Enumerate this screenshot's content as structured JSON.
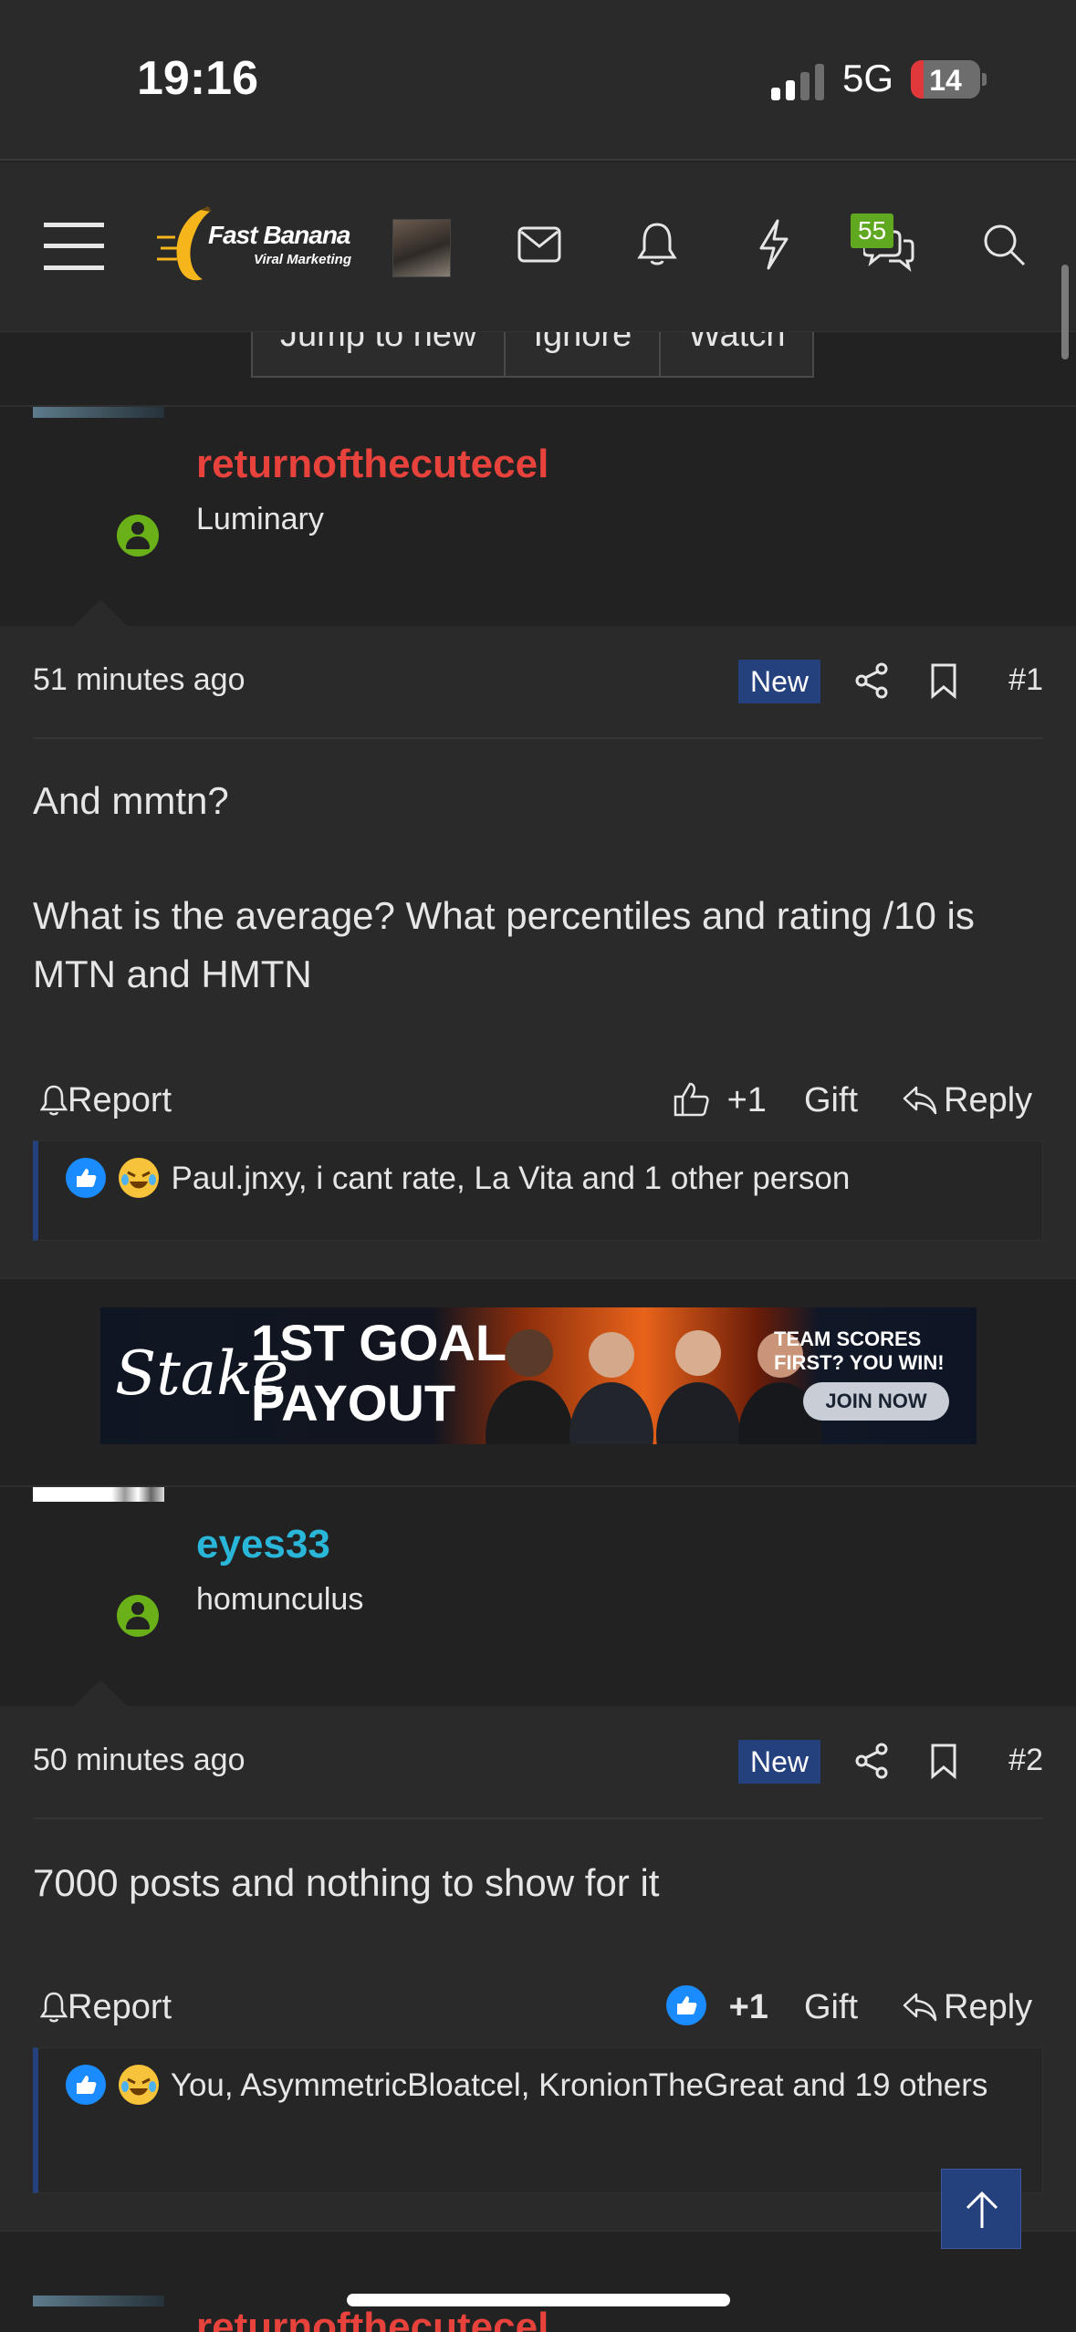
{
  "status_bar": {
    "time": "19:16",
    "network": "5G",
    "battery": "14"
  },
  "nav": {
    "logo_title": "Fast Banana",
    "logo_subtitle": "Viral Marketing",
    "chat_badge": "55",
    "icons": [
      "menu-icon",
      "mail-icon",
      "bell-icon",
      "lightning-icon",
      "chat-icon",
      "search-icon"
    ]
  },
  "thread_tabs": [
    "Jump to new",
    "Ignore",
    "Watch"
  ],
  "posts": [
    {
      "username": "returnofthecutecel",
      "user_color": "#e8423c",
      "user_title": "Luminary",
      "time": "51 minutes ago",
      "new_label": "New",
      "number": "#1",
      "content": [
        "And mmtn?",
        "What is the average? What percentiles and rating /10 is MTN and HMTN"
      ],
      "report": "Report",
      "like_count": "+1",
      "gift": "Gift",
      "reply": "Reply",
      "reactions": "Paul.jnxy, i cant rate, La Vita and 1 other person"
    },
    {
      "username": "eyes33",
      "user_color": "#29b6d8",
      "user_title": "homunculus",
      "time": "50 minutes ago",
      "new_label": "New",
      "number": "#2",
      "content": [
        "7000 posts and nothing to show for it"
      ],
      "report": "Report",
      "like_count": "+1",
      "gift": "Gift",
      "reply": "Reply",
      "reactions": "You, AsymmetricBloatcel, KronionTheGreat and 19 others"
    },
    {
      "username": "returnofthecutecel",
      "user_color": "#e8423c"
    }
  ],
  "ad": {
    "brand": "Stake",
    "headline_1": "1ST GOAL",
    "headline_2": "PAYOUT",
    "tagline": "TEAM SCORES FIRST? YOU WIN!",
    "cta": "JOIN NOW"
  }
}
